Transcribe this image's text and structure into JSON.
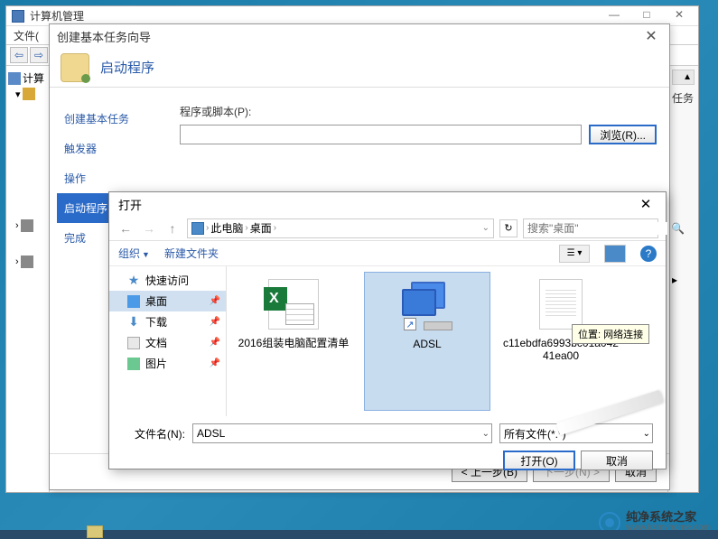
{
  "cmp": {
    "title": "计算机管理",
    "menu_file": "文件(",
    "right_label": "任务"
  },
  "wizard": {
    "title": "创建基本任务向导",
    "header": "启动程序",
    "steps": {
      "create": "创建基本任务",
      "trigger": "触发器",
      "action": "操作",
      "start_program": "启动程序",
      "finish": "完成"
    },
    "program_label": "程序或脚本(P):",
    "program_value": "",
    "browse_btn": "浏览(R)...",
    "back_btn": "< 上一步(B)",
    "next_btn": "下一步(N) >",
    "cancel_btn": "取消"
  },
  "open": {
    "title": "打开",
    "crumb_pc": "此电脑",
    "crumb_desktop": "桌面",
    "search_placeholder": "搜索\"桌面\"",
    "organize": "组织",
    "new_folder": "新建文件夹",
    "help": "?",
    "side": {
      "quick": "快速访问",
      "desktop": "桌面",
      "downloads": "下载",
      "documents": "文档",
      "pictures": "图片"
    },
    "files": {
      "f1": "2016组装电脑配置清单",
      "f2": "ADSL",
      "f3": "c11ebdfa6993bc01a04241ea00"
    },
    "tooltip": "位置: 网络连接",
    "filename_label": "文件名(N):",
    "filename_value": "ADSL",
    "filter": "所有文件(*.*)",
    "open_btn": "打开(O)",
    "cancel_btn": "取消"
  },
  "watermark": {
    "cn": "纯净系统之家",
    "url": "www.kzmyhome.com"
  }
}
